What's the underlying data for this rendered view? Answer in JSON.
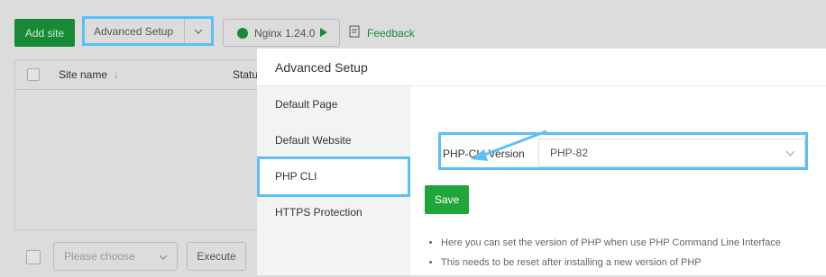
{
  "toolbar": {
    "add_site_label": "Add site",
    "advanced_setup_label": "Advanced Setup",
    "nginx_label": "Nginx 1.24.0",
    "feedback_label": "Feedback"
  },
  "table": {
    "columns": [
      "Site name",
      "Status"
    ]
  },
  "footer": {
    "select_placeholder": "Please choose",
    "execute_label": "Execute"
  },
  "dialog": {
    "title": "Advanced Setup",
    "nav_items": [
      {
        "label": "Default Page",
        "active": false
      },
      {
        "label": "Default Website",
        "active": false
      },
      {
        "label": "PHP CLI",
        "active": true
      },
      {
        "label": "HTTPS Protection",
        "active": false
      }
    ],
    "php_cli": {
      "field_label": "PHP-CLI Version",
      "selected_value": "PHP-82",
      "save_label": "Save",
      "tips": [
        "Here you can set the version of PHP when use PHP Command Line Interface",
        "This needs to be reset after installing a new version of PHP"
      ]
    }
  },
  "colors": {
    "accent_green": "#20a53a",
    "highlight_blue": "#5bc0f5"
  },
  "icons": [
    "sort-icon",
    "chevron-down-icon",
    "nginx-icon",
    "play-icon",
    "feedback-icon"
  ]
}
